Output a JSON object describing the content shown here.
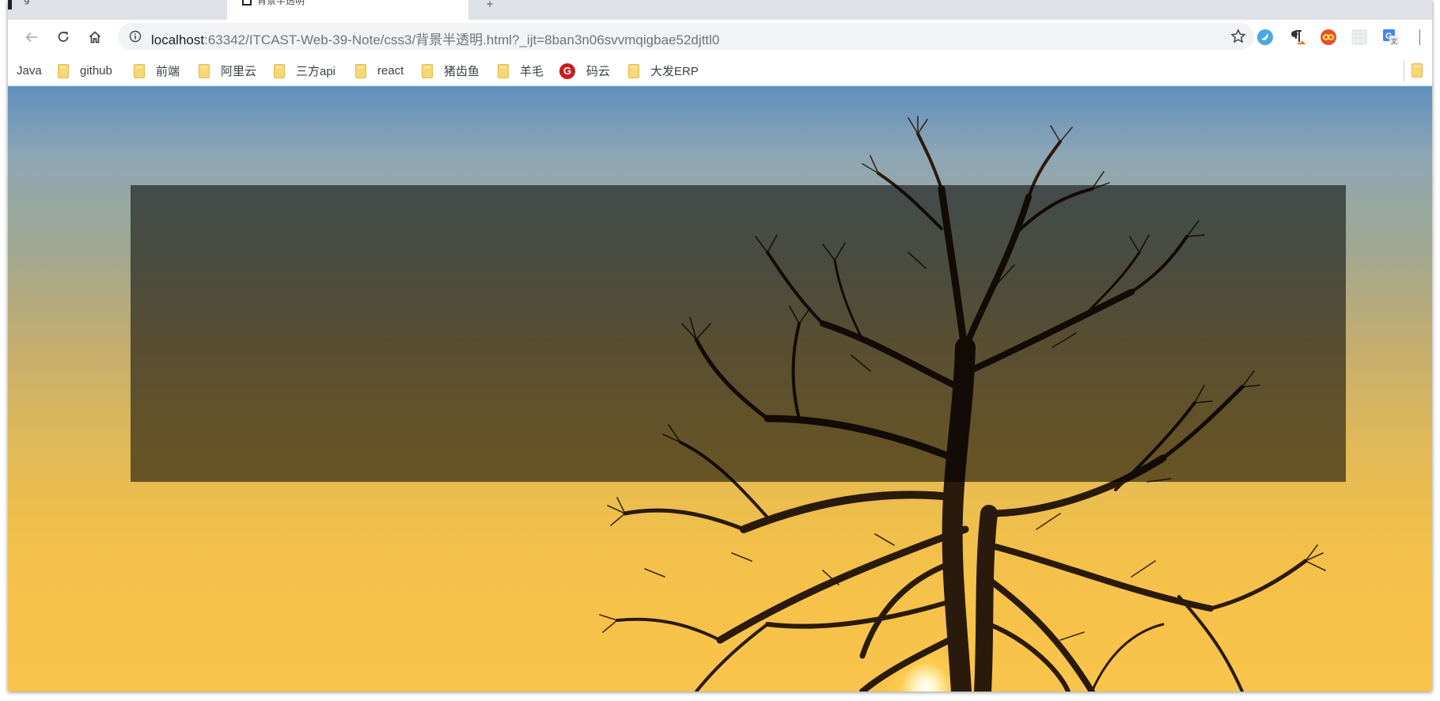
{
  "tabs": [
    {
      "label": "g"
    },
    {
      "label": "背景半透明"
    }
  ],
  "toolbar": {
    "url_host": "localhost",
    "url_rest": ":63342/ITCAST-Web-39-Note/css3/背景半透明.html?_ijt=8ban3n06svvmqigbae52djttl0"
  },
  "bookmarks": [
    {
      "label": "Java",
      "icon": "none"
    },
    {
      "label": "github",
      "icon": "folder-icon"
    },
    {
      "label": "前端",
      "icon": "folder-icon"
    },
    {
      "label": "阿里云",
      "icon": "folder-icon"
    },
    {
      "label": "三方api",
      "icon": "folder-icon"
    },
    {
      "label": "react",
      "icon": "folder-icon"
    },
    {
      "label": "猪齿鱼",
      "icon": "folder-icon"
    },
    {
      "label": "羊毛",
      "icon": "folder-icon"
    },
    {
      "label": "码云",
      "icon": "gitee-icon",
      "icon_glyph": "G"
    },
    {
      "label": "大发ERP",
      "icon": "folder-icon"
    }
  ],
  "colors": {
    "overlay": "rgba(0,0,0,0.55)",
    "sky_top": "#5f8fbd",
    "sky_bottom": "#f9c44c",
    "gitee_red": "#c71d23"
  }
}
